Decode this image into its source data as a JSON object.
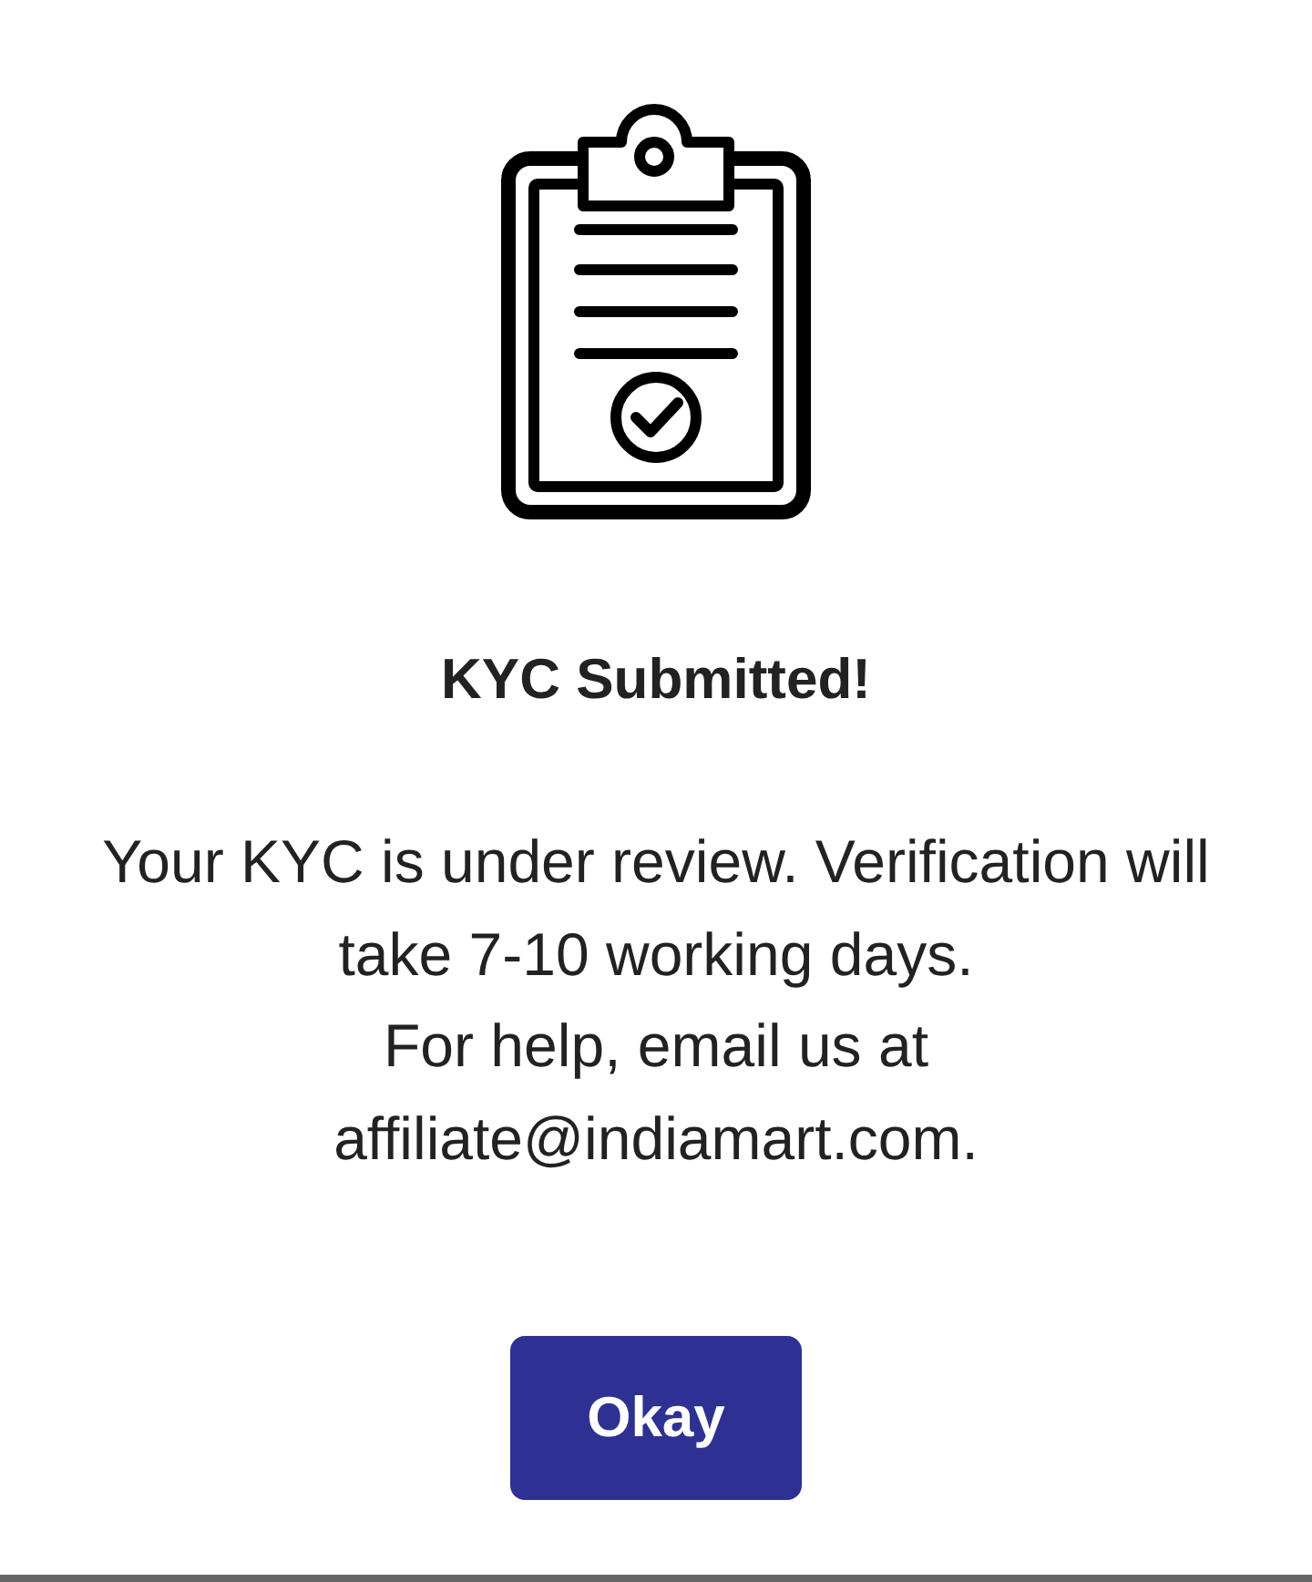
{
  "dialog": {
    "title": "KYC Submitted!",
    "message": "Your KYC is under review. Verification will take 7-10 working days.\nFor help, email us at affiliate@indiamart.com.",
    "button": {
      "label": "Okay"
    }
  }
}
